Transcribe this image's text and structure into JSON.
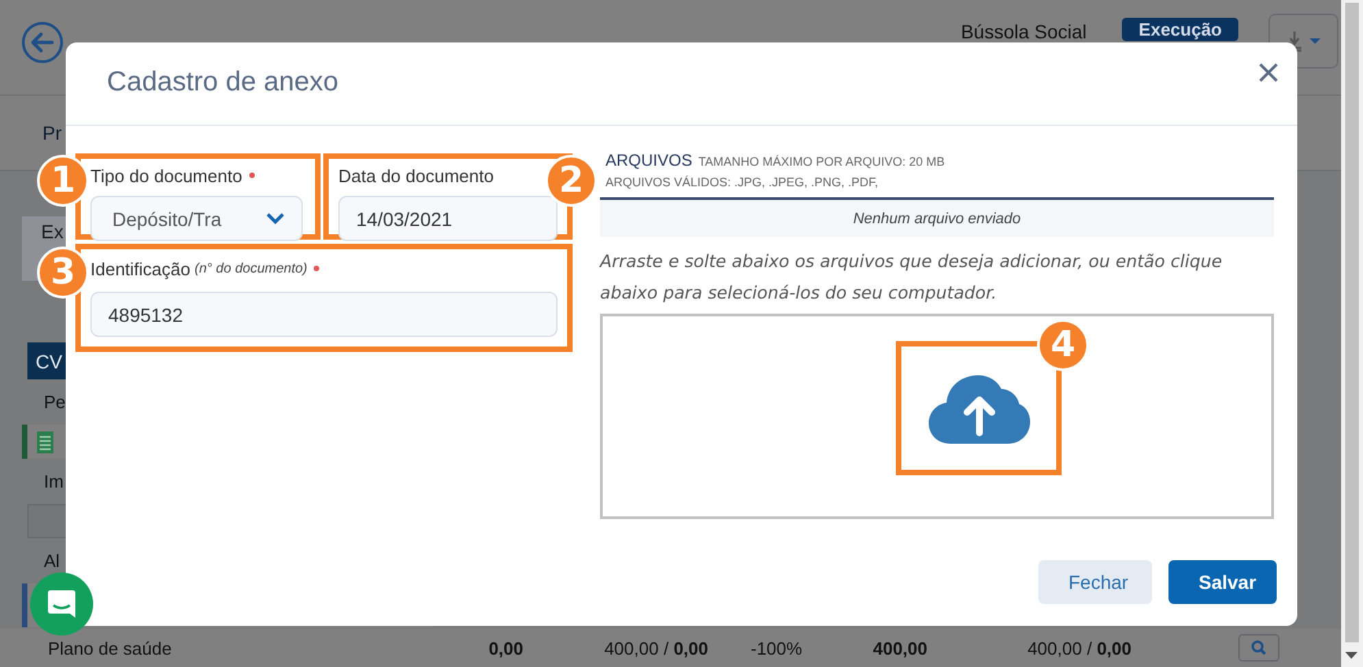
{
  "background": {
    "header": {
      "organization": "Bússola Social",
      "status_badge": "Execução"
    },
    "tab": "Pr",
    "panel_title": "Ex",
    "rows": [
      {
        "kind": "header",
        "label": "CV"
      },
      {
        "kind": "text",
        "label": "Pe"
      },
      {
        "kind": "icon"
      },
      {
        "kind": "text",
        "label": "Im"
      },
      {
        "kind": "button"
      },
      {
        "kind": "text",
        "label": "Al"
      },
      {
        "kind": "band"
      }
    ],
    "summary_row": {
      "label": "Plano de saúde",
      "cells": [
        {
          "text": "0,00",
          "bold": true
        },
        {
          "text": "400,00 / **0,00**",
          "bold": false
        },
        {
          "text": "-100%",
          "bold": false
        },
        {
          "text": "400,00",
          "bold": true
        },
        {
          "text": "400,00 / **0,00**",
          "bold": false
        }
      ]
    }
  },
  "modal": {
    "title": "Cadastro de anexo",
    "fields": [
      {
        "kind": "select",
        "label": "Tipo do documento",
        "required": true,
        "value": "Depósito/Tra",
        "marker": "1",
        "wide": false
      },
      {
        "kind": "input",
        "label": "Data do documento",
        "required": false,
        "value": "14/03/2021",
        "marker": "2",
        "wide": false
      },
      {
        "kind": "input",
        "label": "Identificação",
        "hint": "(n° do documento)",
        "required": true,
        "value": "4895132",
        "marker": "3",
        "wide": true
      }
    ],
    "files": {
      "heading": "ARQUIVOS",
      "max_size": "TAMANHO MÁXIMO POR ARQUIVO: 20 MB",
      "valid_types": "ARQUIVOS VÁLIDOS: .JPG, .JPEG, .PNG, .PDF,",
      "empty_message": "Nenhum arquivo enviado",
      "instructions": "Arraste e solte abaixo os arquivos que deseja adicionar, ou então clique abaixo para selecioná-los do seu computador.",
      "upload_marker": "4"
    },
    "buttons": [
      {
        "label": "Fechar",
        "kind": "secondary"
      },
      {
        "label": "Salvar",
        "kind": "primary"
      }
    ]
  }
}
